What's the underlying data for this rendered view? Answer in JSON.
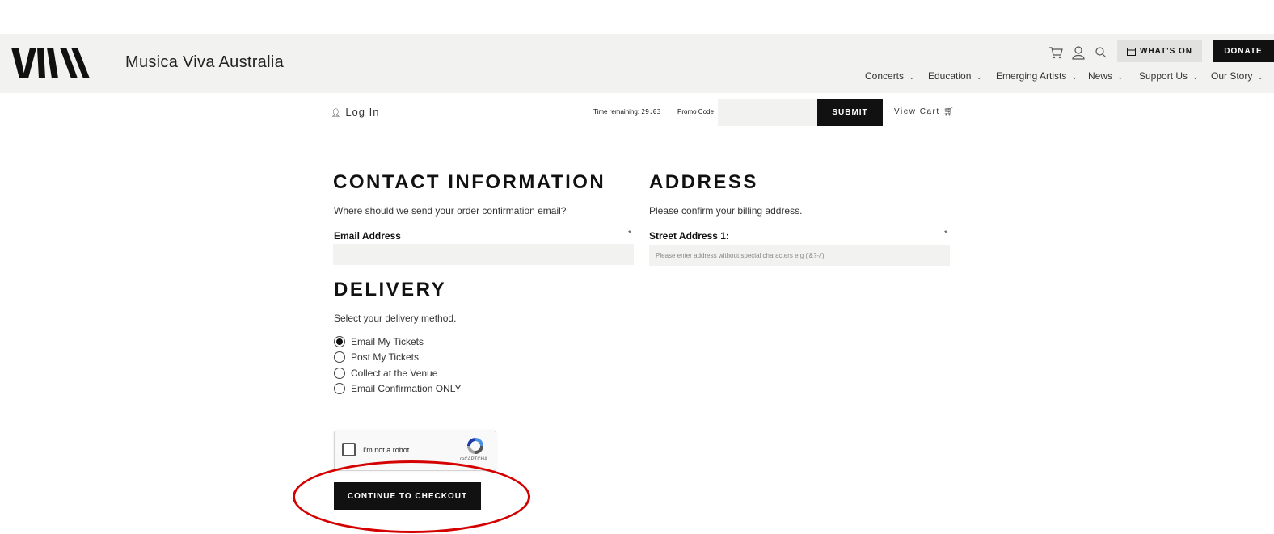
{
  "header": {
    "brand": "Musica Viva Australia",
    "icons": [
      "cart-icon",
      "user-icon",
      "search-icon"
    ],
    "whats_on_label": "WHAT'S ON",
    "donate_label": "DONATE",
    "nav": [
      "Concerts",
      "Education",
      "Emerging Artists",
      "News",
      "Support Us",
      "Our Story"
    ]
  },
  "subbar": {
    "login": "Log In",
    "time_label": "Time remaining:",
    "time_value": "29:03",
    "promo_label": "Promo Code",
    "promo_value": "",
    "submit": "SUBMIT",
    "view_cart": "View Cart"
  },
  "contact": {
    "title": "CONTACT INFORMATION",
    "desc": "Where should we send your order confirmation email?",
    "email_label": "Email Address",
    "email_value": "",
    "required_mark": "*"
  },
  "address": {
    "title": "ADDRESS",
    "desc": "Please confirm your billing address.",
    "street_label": "Street Address 1:",
    "street_placeholder": "Please enter address without special characters e.g ('&?-/')",
    "required_mark": "*"
  },
  "delivery": {
    "title": "DELIVERY",
    "desc": "Select your delivery method.",
    "options": [
      {
        "label": "Email My Tickets",
        "selected": true
      },
      {
        "label": "Post My Tickets",
        "selected": false
      },
      {
        "label": "Collect at the Venue",
        "selected": false
      },
      {
        "label": "Email Confirmation ONLY",
        "selected": false
      }
    ]
  },
  "recaptcha": {
    "label": "I'm not a robot",
    "brand": "reCAPTCHA"
  },
  "checkout_label": "CONTINUE TO CHECKOUT",
  "colors": {
    "header_bg": "#f2f3f1",
    "button_dark": "#111111",
    "highlight_circle": "#d40000"
  }
}
